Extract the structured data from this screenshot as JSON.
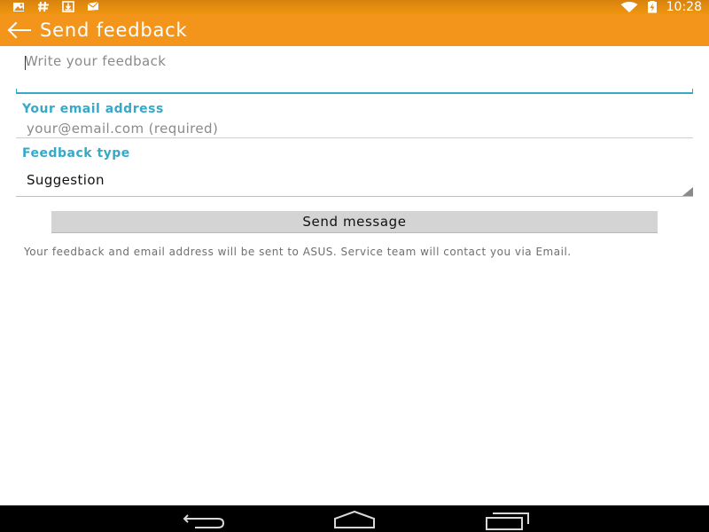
{
  "status_bar": {
    "time": "10:28",
    "icons": [
      "notification-image-icon",
      "hashtag-icon",
      "download-icon",
      "mail-icon",
      "wifi-icon",
      "battery-charging-icon"
    ]
  },
  "app_bar": {
    "title": "Send feedback",
    "back_icon": "arrow-left-icon"
  },
  "form": {
    "feedback": {
      "placeholder": "Write your feedback",
      "value": ""
    },
    "email": {
      "label": "Your email address",
      "placeholder": "your@email.com (required)",
      "value": ""
    },
    "feedback_type": {
      "label": "Feedback type",
      "selected": "Suggestion"
    },
    "send_label": "Send message",
    "notice": "Your feedback and email address will be sent to ASUS. Service team will contact you via Email."
  },
  "colors": {
    "app_bar": "#f2951a",
    "accent": "#35a9c7",
    "button": "#d4d4d4",
    "nav_bar": "#000000"
  },
  "nav_bar": {
    "buttons": [
      "back-nav-icon",
      "home-nav-icon",
      "recents-nav-icon"
    ]
  }
}
